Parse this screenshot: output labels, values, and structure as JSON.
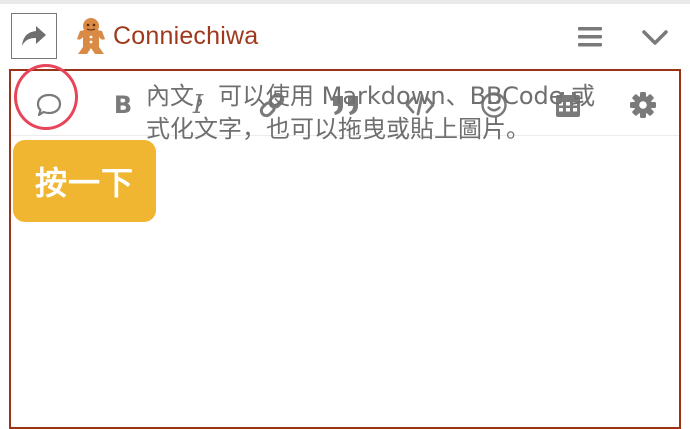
{
  "header": {
    "username": "Conniechiwa",
    "reply_icon": "reply-arrow-icon",
    "avatar": "gingerbread-avatar",
    "menu_icon": "hamburger-menu-icon",
    "collapse_icon": "chevron-down-icon"
  },
  "toolbar": {
    "buttons": [
      {
        "name": "quote",
        "icon": "speech-bubble-icon"
      },
      {
        "name": "bold",
        "icon": "bold-icon",
        "glyph": "B"
      },
      {
        "name": "italic",
        "icon": "italic-icon",
        "glyph": "I"
      },
      {
        "name": "link",
        "icon": "link-icon"
      },
      {
        "name": "blockquote",
        "icon": "quote-marks-icon"
      },
      {
        "name": "code",
        "icon": "code-icon"
      },
      {
        "name": "emoji",
        "icon": "smiley-icon"
      },
      {
        "name": "date",
        "icon": "calendar-icon"
      },
      {
        "name": "options",
        "icon": "gear-icon"
      }
    ],
    "highlight_color": "#e8455b"
  },
  "editor": {
    "placeholder_line1": "內文，可以使用 Markdown、BBCode 或",
    "placeholder_line2": "式化文字，也可以拖曳或貼上圖片。"
  },
  "annotation": {
    "label": "按一下",
    "color": "#f0b632"
  },
  "colors": {
    "brand": "#a0391b",
    "border": "#9c3315",
    "icon": "#7a7a7a"
  }
}
